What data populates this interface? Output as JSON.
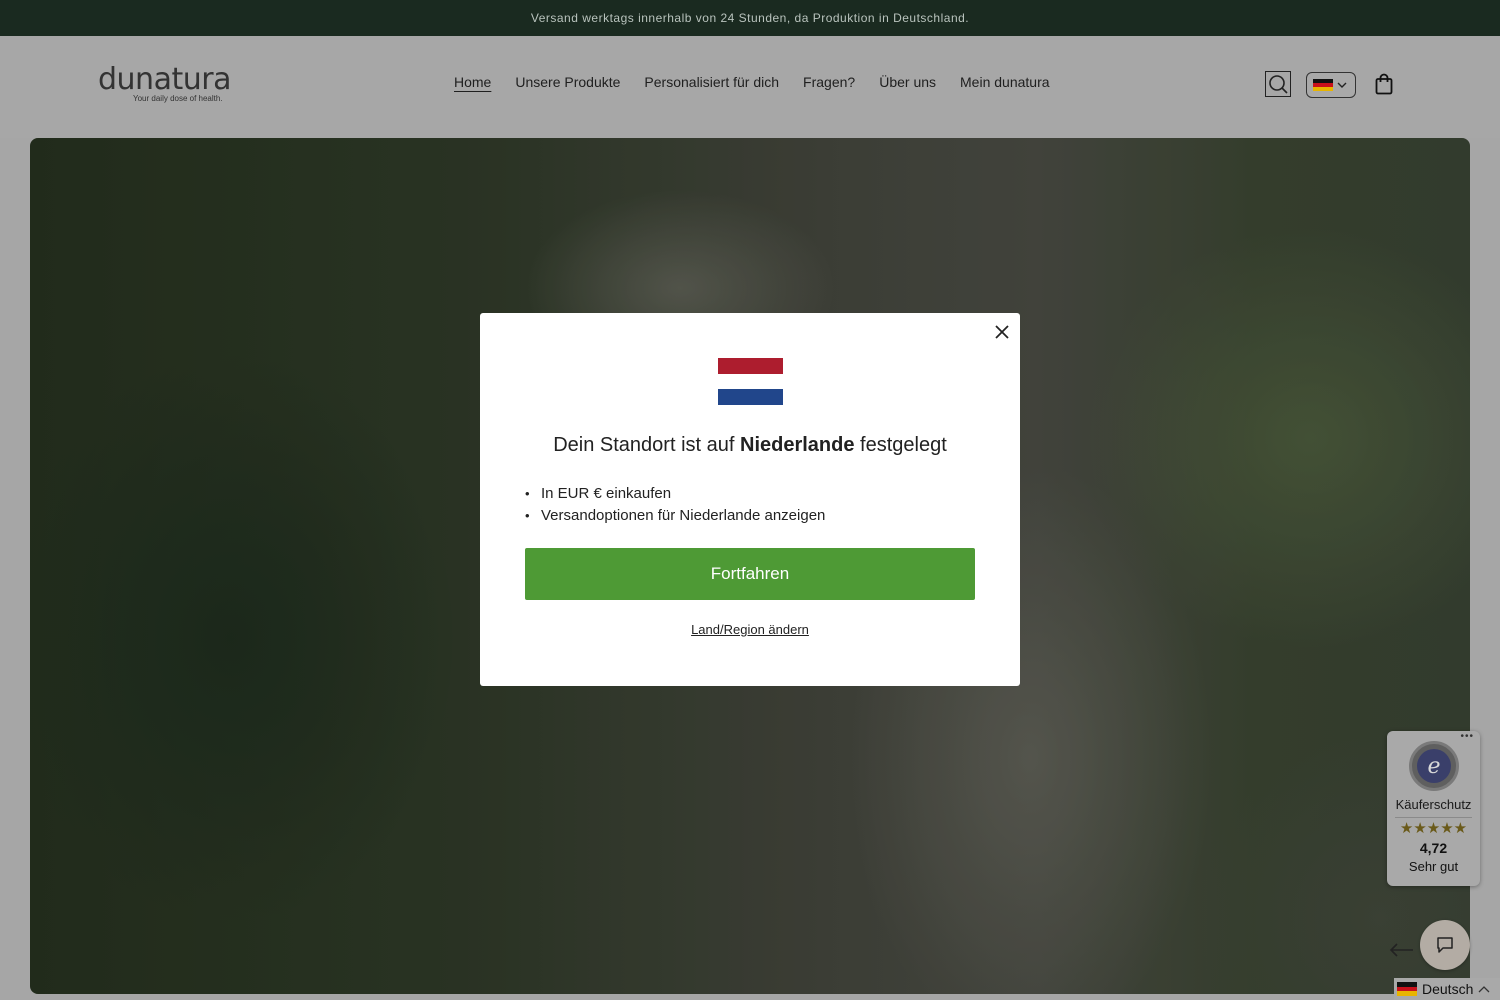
{
  "announcement": {
    "text": "Versand werktags innerhalb von 24 Stunden, da Produktion in Deutschland."
  },
  "header": {
    "logo_text": "dunatura",
    "logo_tagline": "Your daily dose of health.",
    "nav": [
      {
        "label": "Home",
        "active": true
      },
      {
        "label": "Unsere Produkte"
      },
      {
        "label": "Personalisiert für dich"
      },
      {
        "label": "Fragen?"
      },
      {
        "label": "Über uns"
      },
      {
        "label": "Mein dunatura"
      }
    ],
    "icons": {
      "search": "search-icon",
      "language": "german-flag-icon",
      "cart": "shopping-bag-icon"
    }
  },
  "modal": {
    "title_prefix": "Dein Standort ist auf ",
    "title_country": "Niederlande",
    "title_suffix": " festgelegt",
    "bullets": [
      "In EUR € einkaufen",
      "Versandoptionen für Niederlande anzeigen"
    ],
    "continue_label": "Fortfahren",
    "change_link": "Land/Region ändern",
    "flag_colors": [
      "#ad1d2e",
      "#ffffff",
      "#21468b"
    ]
  },
  "trusted_shops": {
    "label": "Käuferschutz",
    "stars": "★★★★★",
    "rating": "4,72",
    "grade": "Sehr gut"
  },
  "language_switcher": {
    "label": "Deutsch"
  },
  "colors": {
    "announcement_bg": "#1a2a20",
    "continue_button": "#4e9a35"
  }
}
